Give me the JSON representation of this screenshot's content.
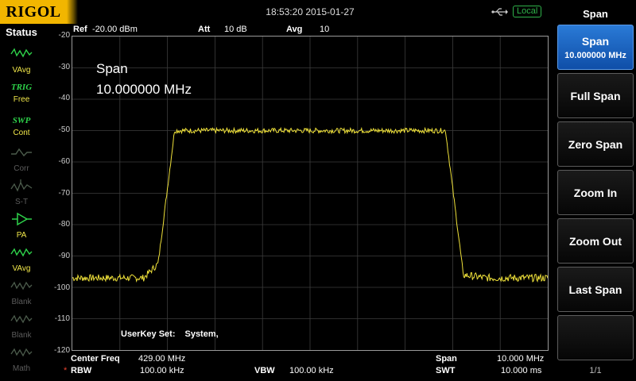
{
  "header": {
    "brand": "RIGOL",
    "datetime": "18:53:20 2015-01-27",
    "local_badge": "Local",
    "usb_icon": "usb-icon"
  },
  "status": {
    "title": "Status",
    "items": [
      {
        "glyph": "VAvg",
        "label": "VAvg",
        "active": true,
        "icon": "video-average-icon"
      },
      {
        "glyph": "TRIG",
        "label": "Free",
        "active": true,
        "icon": "trigger-icon"
      },
      {
        "glyph": "SWP",
        "label": "Cont",
        "active": true,
        "icon": "sweep-icon"
      },
      {
        "glyph": "",
        "label": "Corr",
        "active": false,
        "icon": "correction-icon"
      },
      {
        "glyph": "",
        "label": "S-T",
        "active": false,
        "icon": "source-tracking-icon"
      },
      {
        "glyph": "",
        "label": "PA",
        "active": true,
        "icon": "preamp-icon"
      },
      {
        "glyph": "",
        "label": "VAvg",
        "active": true,
        "icon": "trace-avg-icon"
      },
      {
        "glyph": "",
        "label": "Blank",
        "active": false,
        "icon": "blank-trace-icon"
      },
      {
        "glyph": "",
        "label": "Blank",
        "active": false,
        "icon": "blank-trace-icon"
      },
      {
        "glyph": "",
        "label": "Math",
        "active": false,
        "icon": "math-trace-icon"
      }
    ]
  },
  "measure": {
    "ref_label": "Ref",
    "ref_value": "-20.00 dBm",
    "att_label": "Att",
    "att_value": "10 dB",
    "avg_label": "Avg",
    "avg_value": "10"
  },
  "overlay": {
    "param_name": "Span",
    "param_value": "10.000000 MHz"
  },
  "userkey": {
    "label": "UserKey Set:",
    "value": "System,"
  },
  "bottom": {
    "center_label": "Center Freq",
    "center_value": "429.00 MHz",
    "span_label": "Span",
    "span_value": "10.000 MHz",
    "rbw_label": "RBW",
    "rbw_value": "100.00 kHz",
    "vbw_label": "VBW",
    "vbw_value": "100.00 kHz",
    "swt_label": "SWT",
    "swt_value": "10.000 ms",
    "rbw_marker": "*"
  },
  "menu": {
    "title": "Span",
    "items": [
      {
        "label": "Span",
        "sub": "10.000000 MHz",
        "active": true
      },
      {
        "label": "Full Span",
        "sub": "",
        "active": false
      },
      {
        "label": "Zero Span",
        "sub": "",
        "active": false
      },
      {
        "label": "Zoom In",
        "sub": "",
        "active": false
      },
      {
        "label": "Zoom Out",
        "sub": "",
        "active": false
      },
      {
        "label": "Last Span",
        "sub": "",
        "active": false
      },
      {
        "label": "",
        "sub": "",
        "active": false
      }
    ],
    "page": "1/1"
  },
  "display": {
    "y_ticks": [
      "-20",
      "-30",
      "-40",
      "-50",
      "-60",
      "-70",
      "-80",
      "-90",
      "-100",
      "-110",
      "-120"
    ],
    "y_range": [
      -120,
      -20
    ],
    "grid_divisions_x": 10,
    "grid_divisions_y": 10,
    "trace_color": "#f0e23a",
    "grid_color": "#3c3c3c",
    "trace_profile": {
      "noise_floor_dbm": -97,
      "plateau_dbm": -50,
      "edges_fraction": [
        0.2,
        0.8
      ]
    }
  }
}
